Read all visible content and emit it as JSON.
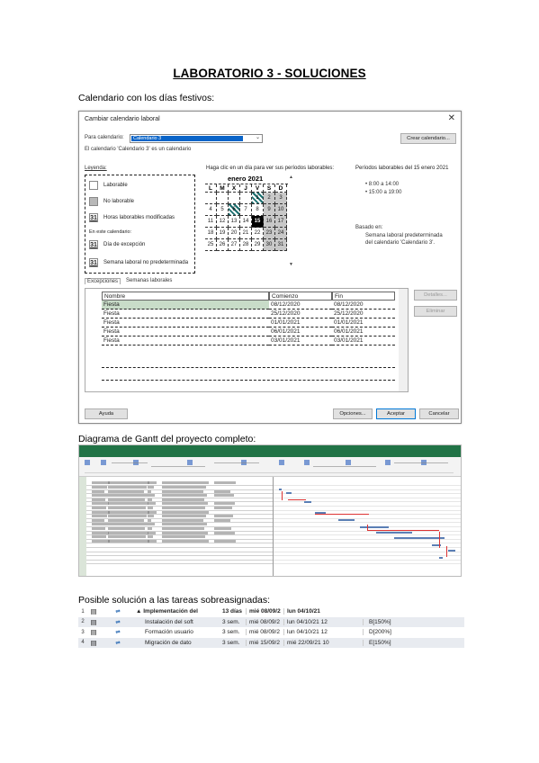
{
  "document": {
    "title": "LABORATORIO 3 - SOLUCIONES",
    "section1_heading": "Calendario con los días festivos:",
    "section2_heading": "Diagrama de Gantt del proyecto completo:",
    "section3_heading": "Posible solución a las tareas sobreasignadas:"
  },
  "calendar_dialog": {
    "title": "Cambiar calendario laboral",
    "close_glyph": "✕",
    "for_calendar_label": "Para calendario:",
    "for_calendar_value": "Calendario 3",
    "base_calendar_note": "El calendario 'Calendario 3' es un calendario",
    "create_calendar_button": "Crear calendario...",
    "legend_label": "Leyenda:",
    "legend_items": [
      {
        "label": "Laborable",
        "swatch": ""
      },
      {
        "label": "No laborable",
        "swatch": ""
      },
      {
        "label": "Horas laborables modificadas",
        "swatch": "31"
      },
      {
        "label": "En este calendario:",
        "swatch": ""
      },
      {
        "label": "Día de excepción",
        "swatch": "31"
      },
      {
        "label": "Semana laboral no predeterminada",
        "swatch": "31"
      }
    ],
    "calendar_prompt": "Haga clic en un día para ver sus períodos laborables:",
    "month_label": "enero 2021",
    "weekday_headers": [
      "L",
      "M",
      "X",
      "J",
      "V",
      "S",
      "D"
    ],
    "weeks": [
      [
        "",
        "",
        "",
        "",
        "1",
        "2",
        "3"
      ],
      [
        "4",
        "5",
        "6",
        "7",
        "8",
        "9",
        "10"
      ],
      [
        "11",
        "12",
        "13",
        "14",
        "15",
        "16",
        "17"
      ],
      [
        "18",
        "19",
        "20",
        "21",
        "22",
        "23",
        "24"
      ],
      [
        "25",
        "26",
        "27",
        "28",
        "29",
        "30",
        "31"
      ]
    ],
    "working_periods_title": "Períodos laborables del 15 enero 2021",
    "working_periods": [
      "8:00 a 14:00",
      "15:00 a 19:00"
    ],
    "based_on_label": "Basado en:",
    "based_on_text": [
      "Semana laboral predeterminada",
      "del calendario 'Calendario 3'."
    ],
    "tabs": [
      "Excepciones",
      "Semanas laborales"
    ],
    "table_headers": [
      "Nombre",
      "Comienzo",
      "Fin"
    ],
    "table_rows": [
      {
        "name": "Fiesta",
        "start": "08/12/2020",
        "end": "08/12/2020"
      },
      {
        "name": "Fiesta",
        "start": "25/12/2020",
        "end": "25/12/2020"
      },
      {
        "name": "Fiesta",
        "start": "01/01/2021",
        "end": "01/01/2021"
      },
      {
        "name": "Fiesta",
        "start": "06/01/2021",
        "end": "06/01/2021"
      },
      {
        "name": "Fiesta",
        "start": "03/01/2021",
        "end": "03/01/2021"
      }
    ],
    "details_button": "Detalles...",
    "delete_button": "Eliminar",
    "help_button": "Ayuda",
    "options_button": "Opciones...",
    "ok_button": "Aceptar",
    "cancel_button": "Cancelar"
  },
  "tasks": {
    "rows": [
      {
        "num": "1",
        "icon": "▤",
        "mode": "⇌",
        "name": "▲ Implementación del",
        "duration": "13 días",
        "start": "mié 08/09/2",
        "end": "lun 04/10/21",
        "resources": "",
        "summary": true
      },
      {
        "num": "2",
        "icon": "▤",
        "mode": "⇌",
        "name": "Instalación del soft",
        "duration": "3 sem.",
        "start": "mié 08/09/2",
        "end": "lun 04/10/21 12",
        "resources": "B[150%]",
        "summary": false
      },
      {
        "num": "3",
        "icon": "▤",
        "mode": "⇌",
        "name": "Formación usuario",
        "duration": "3 sem.",
        "start": "mié 08/09/2",
        "end": "lun 04/10/21 12",
        "resources": "D[200%]",
        "summary": false
      },
      {
        "num": "4",
        "icon": "▤",
        "mode": "⇌",
        "name": "Migración de dato",
        "duration": "3 sem.",
        "start": "mié 15/09/2",
        "end": "mié 22/09/21 10",
        "resources": "E[150%]",
        "summary": false
      }
    ]
  },
  "colors": {
    "project_green": "#217346",
    "selection_blue": "#0a64c8",
    "link_red": "#dd3333"
  }
}
